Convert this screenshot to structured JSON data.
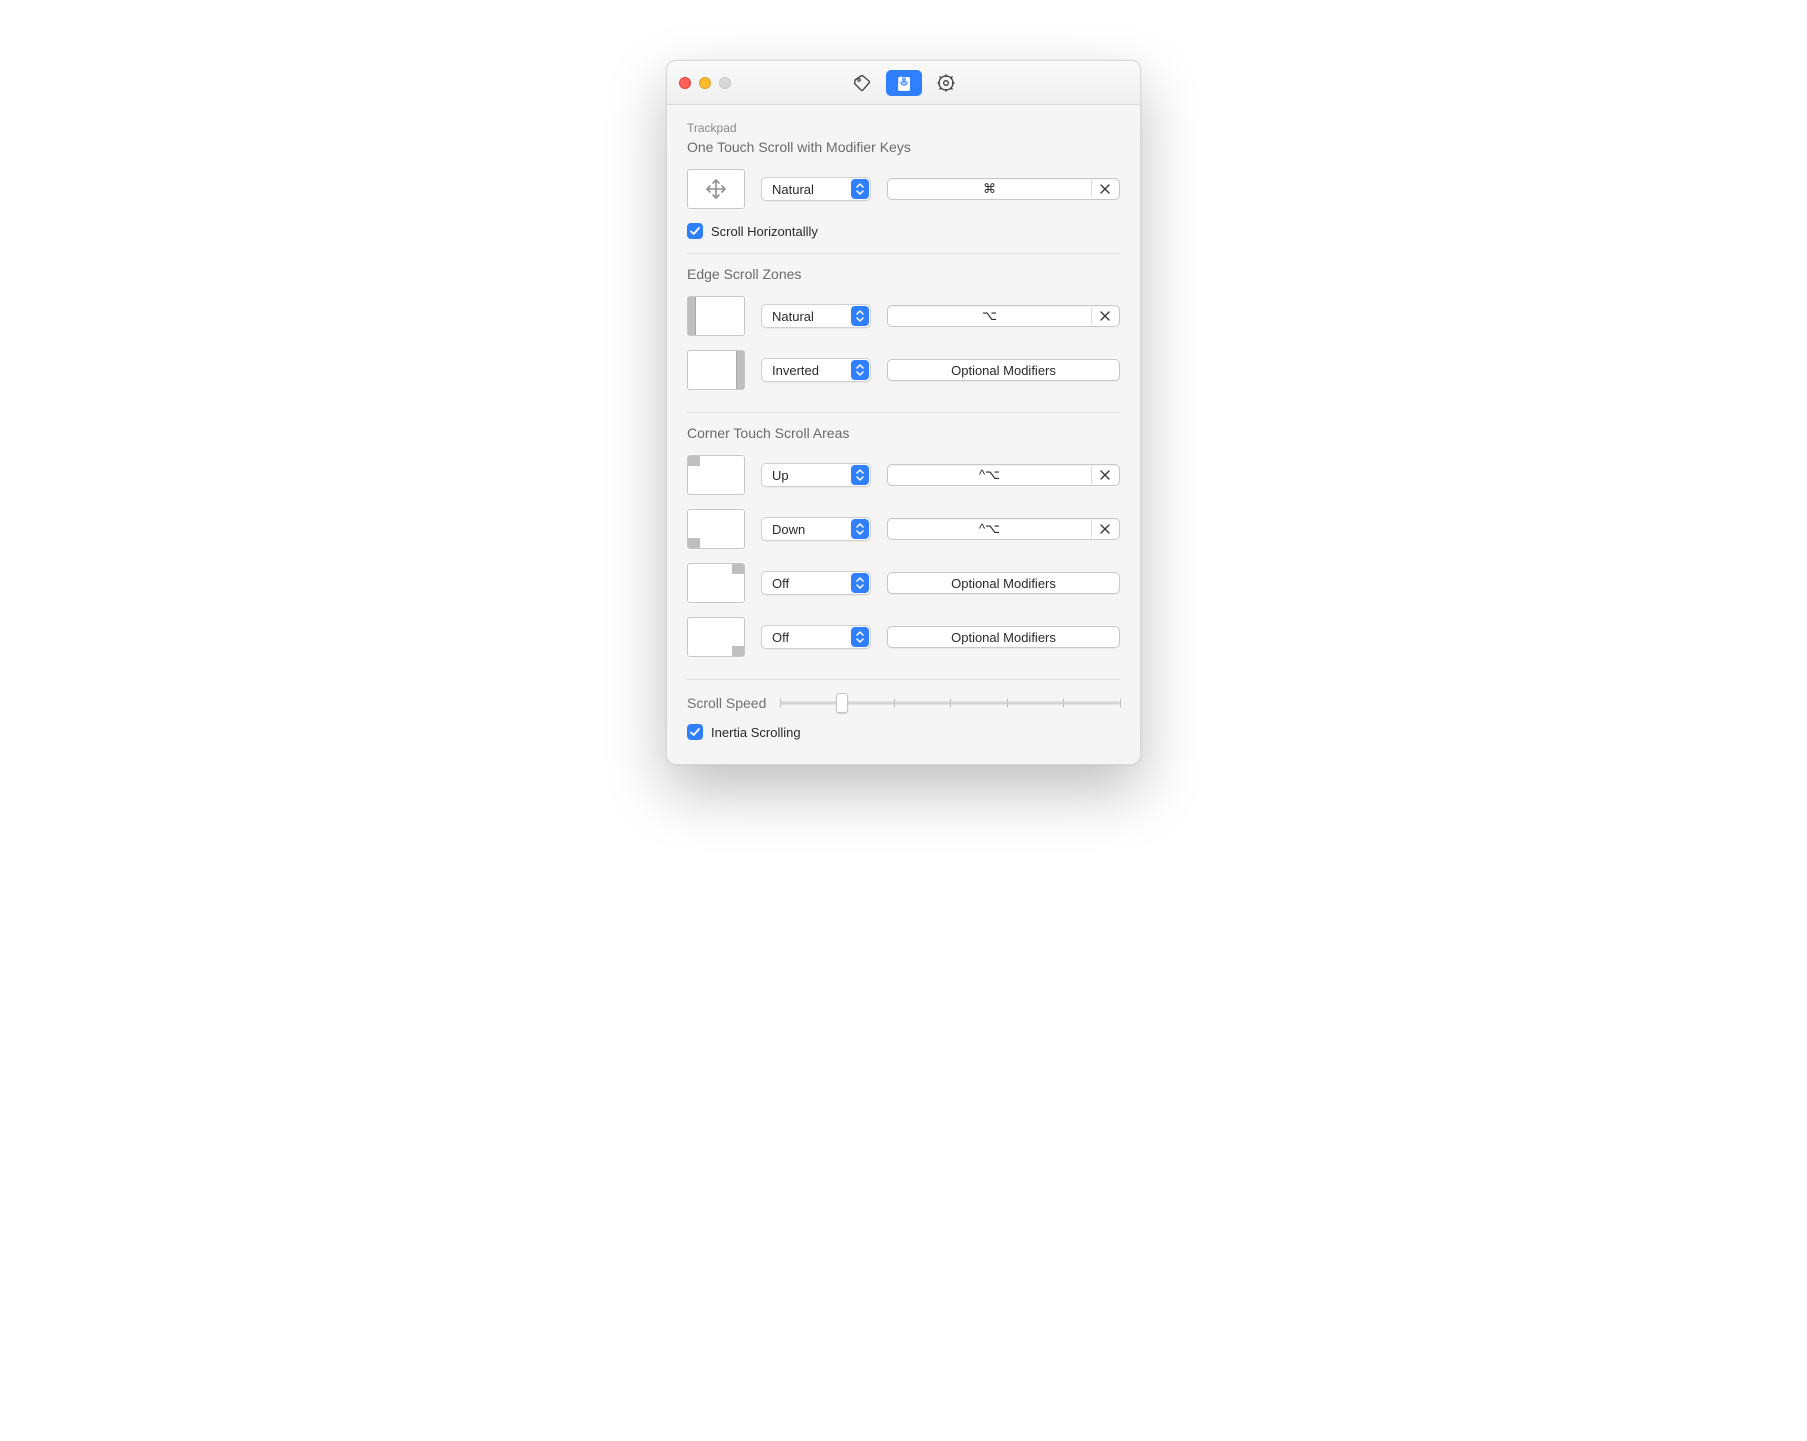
{
  "header": {
    "breadcrumb": "Trackpad"
  },
  "sections": {
    "one_touch": {
      "title": "One Touch Scroll with Modifier Keys",
      "row": {
        "select_value": "Natural",
        "modifier_value": "⌘"
      },
      "scroll_horizontally_label": "Scroll Horizontallly",
      "scroll_horizontally_checked": true
    },
    "edge_zones": {
      "title": "Edge Scroll Zones",
      "left": {
        "select_value": "Natural",
        "modifier_value": "⌥"
      },
      "right": {
        "select_value": "Inverted",
        "modifier_button_label": "Optional Modifiers"
      }
    },
    "corner_areas": {
      "title": "Corner Touch Scroll Areas",
      "tl": {
        "select_value": "Up",
        "modifier_value": "^⌥"
      },
      "bl": {
        "select_value": "Down",
        "modifier_value": "^⌥"
      },
      "tr": {
        "select_value": "Off",
        "modifier_button_label": "Optional Modifiers"
      },
      "br": {
        "select_value": "Off",
        "modifier_button_label": "Optional Modifiers"
      }
    },
    "scroll_speed": {
      "label": "Scroll Speed",
      "value_percent": 18,
      "tick_count": 7
    },
    "inertia": {
      "label": "Inertia Scrolling",
      "checked": true
    }
  }
}
